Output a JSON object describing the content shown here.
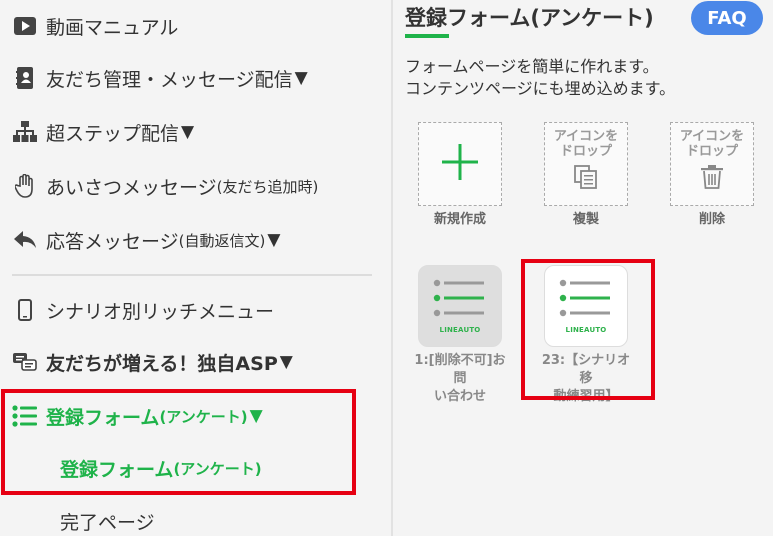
{
  "sidebar": {
    "items": [
      {
        "label": "動画マニュアル"
      },
      {
        "label": "友だち管理・メッセージ配信",
        "arrow": "▼"
      },
      {
        "label": "超ステップ配信",
        "arrow": "▼"
      },
      {
        "label": "あいさつメッセージ",
        "suffix": "(友だち追加時)"
      },
      {
        "label": "応答メッセージ",
        "suffix": "(自動返信文)",
        "arrow": "▼"
      },
      {
        "label": "シナリオ別リッチメニュー"
      },
      {
        "label": "友だちが増える！独自ASP",
        "arrow": "▼"
      },
      {
        "label": "登録フォーム",
        "suffix": "(アンケート)",
        "arrow": "▼"
      }
    ],
    "sub_items": [
      {
        "label": "登録フォーム",
        "suffix": "(アンケート)"
      },
      {
        "label": "完了ページ"
      }
    ]
  },
  "main": {
    "title": "登録フォーム(アンケート)",
    "faq_label": "FAQ",
    "description": [
      "フォームページを簡単に作れます。",
      "コンテンツページにも埋め込めます。"
    ],
    "tools": [
      {
        "label": "新規作成"
      },
      {
        "drop_text_1": "アイコンを",
        "drop_text_2": "ドロップ",
        "label": "複製"
      },
      {
        "drop_text_1": "アイコンを",
        "drop_text_2": "ドロップ",
        "label": "削除"
      }
    ],
    "forms": [
      {
        "logo": "LINEAUTO",
        "label_1": "1:[削除不可]お問",
        "label_2": "い合わせ"
      },
      {
        "logo": "LINEAUTO",
        "label_1": "23:【シナリオ移",
        "label_2": "動練習用】"
      }
    ]
  },
  "colors": {
    "accent": "#1fb34a",
    "highlight": "#e60012",
    "faq": "#4a87e8"
  }
}
